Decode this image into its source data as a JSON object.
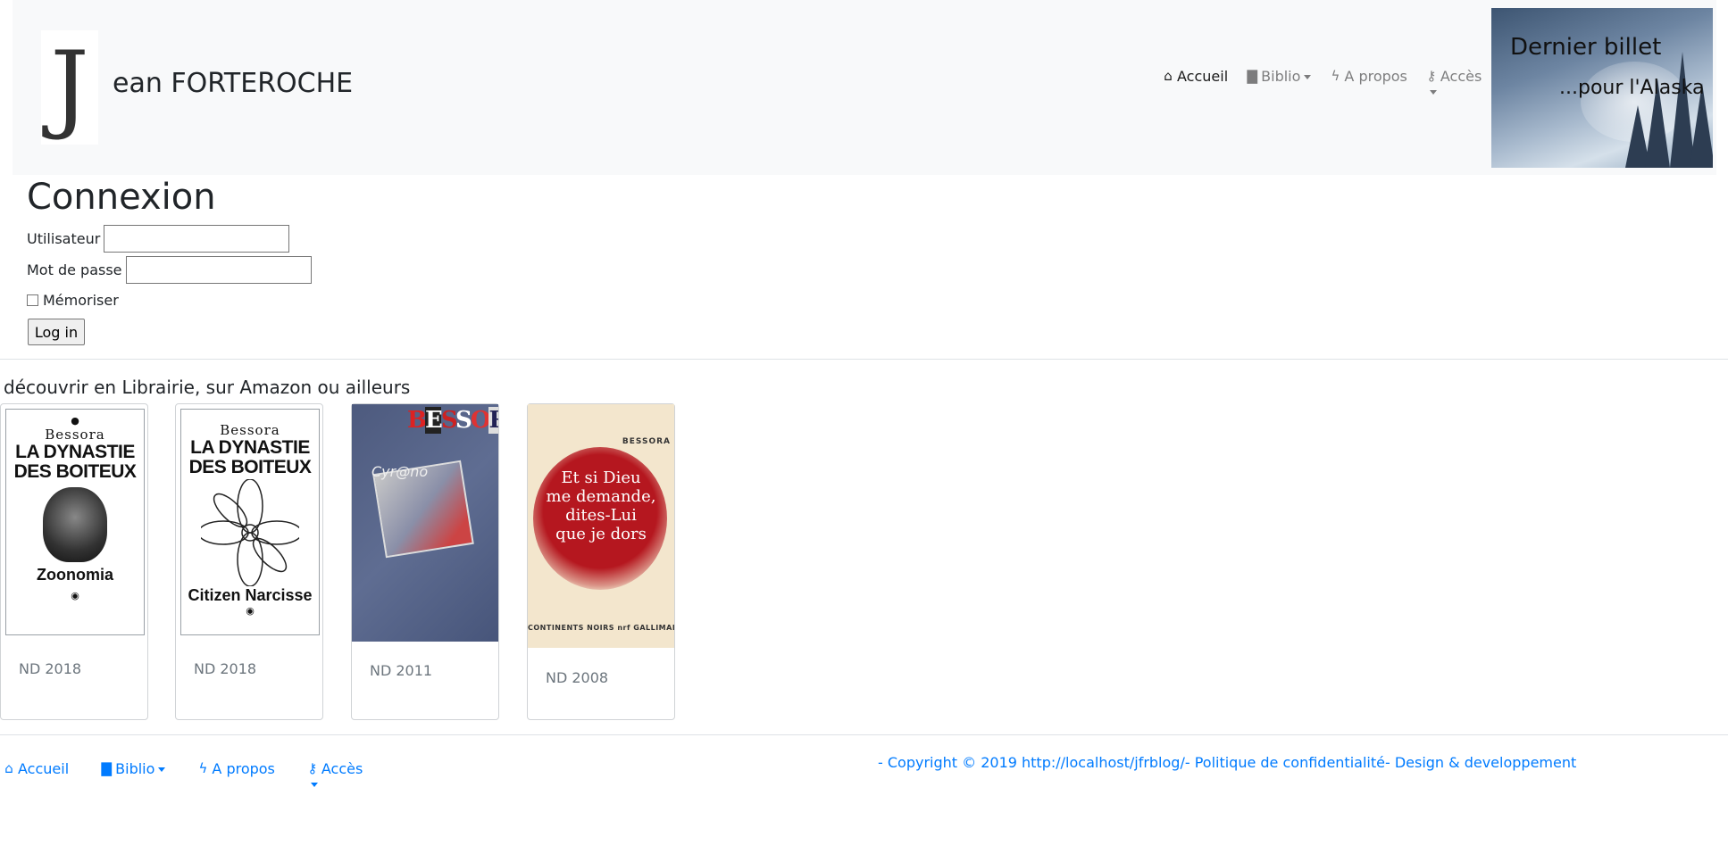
{
  "header": {
    "brand_initial": "J",
    "brand_text": "ean FORTEROCHE",
    "nav": [
      {
        "label": "Accueil",
        "icon": "home-icon",
        "active": true
      },
      {
        "label": "Biblio",
        "icon": "book-icon",
        "dropdown": true
      },
      {
        "label": "A propos",
        "icon": "bolt-icon"
      },
      {
        "label": "Accès",
        "icon": "key-icon",
        "dropdown": true
      }
    ],
    "hero": {
      "title": "Dernier billet",
      "subtitle": "...pour l'Alaska"
    }
  },
  "login": {
    "title": "Connexion",
    "user_label": "Utilisateur",
    "user_value": "",
    "password_label": "Mot de passe",
    "password_value": "",
    "remember_label": "Mémoriser",
    "remember_checked": false,
    "submit_label": "Log in"
  },
  "books": {
    "heading": "découvrir en Librairie, sur Amazon ou ailleurs",
    "items": [
      {
        "year": "ND 2018",
        "cover": {
          "author": "Bessora",
          "title_line1": "LA DYNASTIE",
          "title_line2": "DES BOITEUX",
          "subtitle": "Zoonomia"
        }
      },
      {
        "year": "ND 2018",
        "cover": {
          "author": "Bessora",
          "title_line1": "LA DYNASTIE",
          "title_line2": "DES BOITEUX",
          "subtitle": "Citizen Narcisse"
        }
      },
      {
        "year": "ND 2011",
        "cover": {
          "author": "BESSORA",
          "title": "Cyr@no"
        }
      },
      {
        "year": "ND 2008",
        "cover": {
          "author": "BESSORA",
          "title": "Et si Dieu\nme demande,\ndites-Lui\nque je dors",
          "footer": "CONTINENTS NOIRS  nrf  GALLIMARD"
        }
      }
    ]
  },
  "footer": {
    "nav": [
      {
        "label": "Accueil",
        "icon": "home-icon"
      },
      {
        "label": "Biblio",
        "icon": "book-icon",
        "dropdown": true
      },
      {
        "label": "A propos",
        "icon": "bolt-icon"
      },
      {
        "label": "Accès",
        "icon": "key-icon",
        "dropdown": true
      }
    ],
    "copyright": "- Copyright © 2019 http://localhost/jfrblog/- Politique de confidentialité- Design & developpement"
  },
  "colors": {
    "link": "#007bff",
    "navbar_bg": "#f8f9fa",
    "cover_red": "#b5171f"
  }
}
